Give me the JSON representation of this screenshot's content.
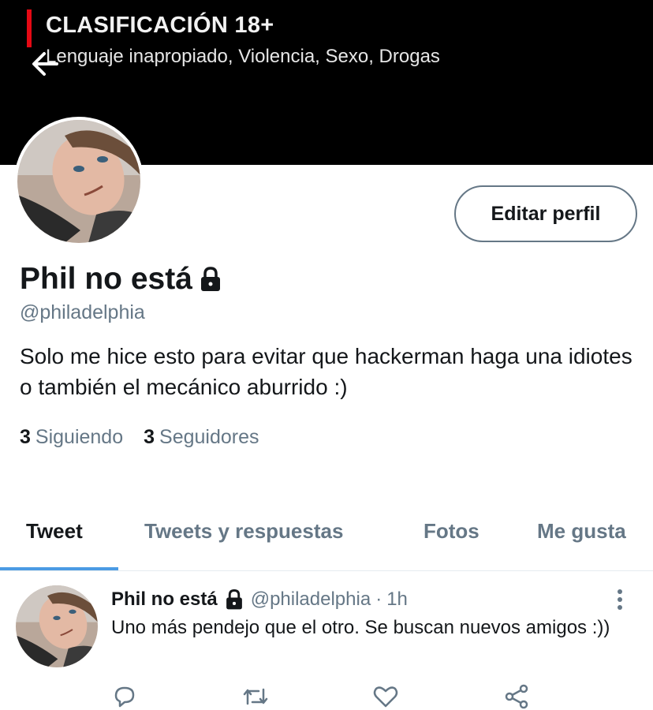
{
  "header": {
    "rating_title": "CLASIFICACIÓN 18+",
    "rating_desc": "Lenguaje inapropiado, Violencia, Sexo, Drogas"
  },
  "profile": {
    "edit_label": "Editar perfil",
    "name": "Phil no está",
    "handle": "@philadelphia",
    "bio": "Solo me hice esto para evitar que hackerman haga una idiotes o también el mecánico aburrido :)",
    "following_count": "3",
    "following_label": "Siguiendo",
    "followers_count": "3",
    "followers_label": "Seguidores"
  },
  "tabs": [
    {
      "label": "Tweet",
      "active": true
    },
    {
      "label": "Tweets y respuestas",
      "active": false
    },
    {
      "label": "Fotos",
      "active": false
    },
    {
      "label": "Me gusta",
      "active": false
    }
  ],
  "tweet": {
    "name": "Phil no está",
    "handle": "@philadelphia",
    "separator": "·",
    "time": "1h",
    "text": "Uno más pendejo que el otro. Se buscan nuevos amigos :))"
  },
  "icons": {
    "back": "arrow-left-icon",
    "lock": "lock-icon",
    "more": "more-vertical-icon",
    "reply": "reply-icon",
    "retweet": "retweet-icon",
    "like": "heart-icon",
    "share": "share-icon"
  },
  "colors": {
    "accent": "#4b9be4",
    "secondary_text": "#657786",
    "rating_bar": "#e50914"
  }
}
